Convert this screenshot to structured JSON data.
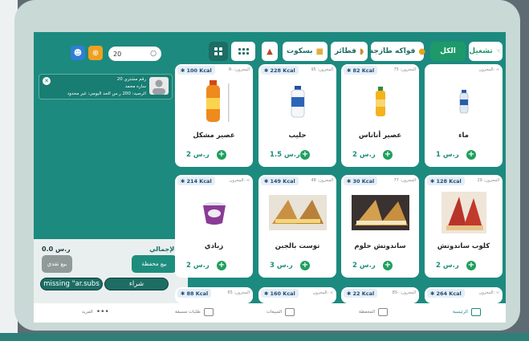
{
  "top_bar": {
    "run_label": "تشغيل",
    "categories": [
      {
        "label": "الكل",
        "icon": "none"
      },
      {
        "label": "فواكه طازجة",
        "icon": "fruit-emoji"
      },
      {
        "label": "فطائر",
        "icon": "pastry-emoji"
      },
      {
        "label": "بسكوت",
        "icon": "biscuit-emoji"
      }
    ],
    "search_value": "20"
  },
  "customer": {
    "number_line": "رقم مشتري 20",
    "name_line": "ساره محمد",
    "balance_line": "الرصيد: 200 ر.س  الحد اليومي: غير محدود"
  },
  "totals": {
    "total_label": "الإجمالي",
    "total_value": "0.0 ر.س",
    "wallet_sale": "بيع محفظة",
    "cash_sale": "بيع نقدي",
    "missing_label": "missing \"ar.subs",
    "buy_label": "شراء"
  },
  "products": [
    {
      "name": "ماء",
      "kcal": "",
      "stock": "المخزون: ∞",
      "price": "1 ر.س",
      "icon": "water-bottle"
    },
    {
      "name": "عصير أناناس",
      "kcal": "82 Kcal",
      "stock": "المخزون: 75",
      "price": "2 ر.س",
      "icon": "juice-bottle"
    },
    {
      "name": "حليب",
      "kcal": "228 Kcal",
      "stock": "المخزون: 95",
      "price": "1.5 ر.س",
      "icon": "milk-bottle"
    },
    {
      "name": "عصير مشكل",
      "kcal": "100 Kcal",
      "stock": "المخزون: -8",
      "price": "2 ر.س",
      "icon": "mixed-juice"
    },
    {
      "name": "كلوب ساندوتش",
      "kcal": "128 Kcal",
      "stock": "المخزون: 29",
      "price": "2 ر.س",
      "icon": "club-sandwich"
    },
    {
      "name": "ساندوتش حلوم",
      "kcal": "30 Kcal",
      "stock": "المخزون: 77",
      "price": "2 ر.س",
      "icon": "halloumi-sandwich"
    },
    {
      "name": "توست بالجبن",
      "kcal": "149 Kcal",
      "stock": "المخزون: 48",
      "price": "3 ر.س",
      "icon": "cheese-toast"
    },
    {
      "name": "زبادي",
      "kcal": "214 Kcal",
      "stock": "المخزون: ∞",
      "price": "2 ر.س",
      "icon": "yogurt-cup"
    }
  ],
  "partial_row": [
    {
      "kcal": "264 Kcal",
      "stock": "المخزون: ∞"
    },
    {
      "kcal": "22 Kcal",
      "stock": "المخزون: -85"
    },
    {
      "kcal": "160 Kcal",
      "stock": "المخزون: ∞"
    },
    {
      "kcal": "88 Kcal",
      "stock": "المخزون: 65"
    }
  ],
  "nav": {
    "home": "الرئيسية",
    "wallet": "المحفظة",
    "sales": "المبيعات",
    "prepaid": "طلبات مسبقة",
    "more": "المزيد"
  },
  "colors": {
    "teal": "#1d8a7f",
    "green": "#1ea05f",
    "dark_teal": "#1d6d64"
  }
}
